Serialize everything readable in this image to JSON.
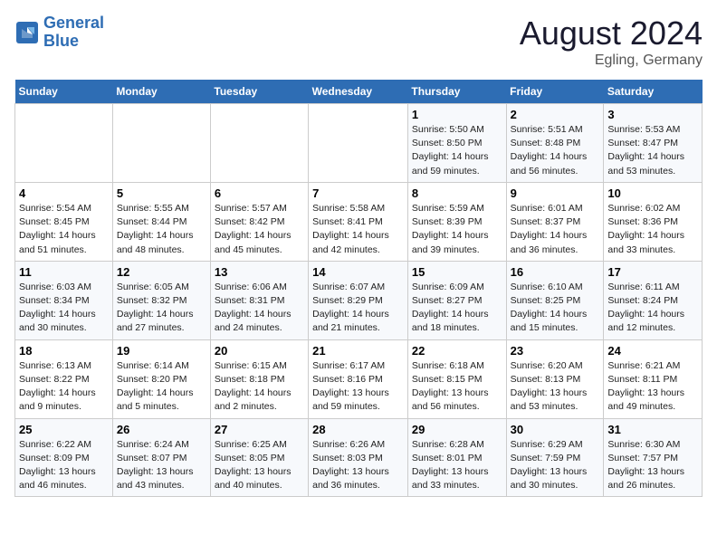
{
  "header": {
    "logo_line1": "General",
    "logo_line2": "Blue",
    "title": "August 2024",
    "subtitle": "Egling, Germany"
  },
  "weekdays": [
    "Sunday",
    "Monday",
    "Tuesday",
    "Wednesday",
    "Thursday",
    "Friday",
    "Saturday"
  ],
  "weeks": [
    [
      {
        "day": "",
        "info": ""
      },
      {
        "day": "",
        "info": ""
      },
      {
        "day": "",
        "info": ""
      },
      {
        "day": "",
        "info": ""
      },
      {
        "day": "1",
        "info": "Sunrise: 5:50 AM\nSunset: 8:50 PM\nDaylight: 14 hours\nand 59 minutes."
      },
      {
        "day": "2",
        "info": "Sunrise: 5:51 AM\nSunset: 8:48 PM\nDaylight: 14 hours\nand 56 minutes."
      },
      {
        "day": "3",
        "info": "Sunrise: 5:53 AM\nSunset: 8:47 PM\nDaylight: 14 hours\nand 53 minutes."
      }
    ],
    [
      {
        "day": "4",
        "info": "Sunrise: 5:54 AM\nSunset: 8:45 PM\nDaylight: 14 hours\nand 51 minutes."
      },
      {
        "day": "5",
        "info": "Sunrise: 5:55 AM\nSunset: 8:44 PM\nDaylight: 14 hours\nand 48 minutes."
      },
      {
        "day": "6",
        "info": "Sunrise: 5:57 AM\nSunset: 8:42 PM\nDaylight: 14 hours\nand 45 minutes."
      },
      {
        "day": "7",
        "info": "Sunrise: 5:58 AM\nSunset: 8:41 PM\nDaylight: 14 hours\nand 42 minutes."
      },
      {
        "day": "8",
        "info": "Sunrise: 5:59 AM\nSunset: 8:39 PM\nDaylight: 14 hours\nand 39 minutes."
      },
      {
        "day": "9",
        "info": "Sunrise: 6:01 AM\nSunset: 8:37 PM\nDaylight: 14 hours\nand 36 minutes."
      },
      {
        "day": "10",
        "info": "Sunrise: 6:02 AM\nSunset: 8:36 PM\nDaylight: 14 hours\nand 33 minutes."
      }
    ],
    [
      {
        "day": "11",
        "info": "Sunrise: 6:03 AM\nSunset: 8:34 PM\nDaylight: 14 hours\nand 30 minutes."
      },
      {
        "day": "12",
        "info": "Sunrise: 6:05 AM\nSunset: 8:32 PM\nDaylight: 14 hours\nand 27 minutes."
      },
      {
        "day": "13",
        "info": "Sunrise: 6:06 AM\nSunset: 8:31 PM\nDaylight: 14 hours\nand 24 minutes."
      },
      {
        "day": "14",
        "info": "Sunrise: 6:07 AM\nSunset: 8:29 PM\nDaylight: 14 hours\nand 21 minutes."
      },
      {
        "day": "15",
        "info": "Sunrise: 6:09 AM\nSunset: 8:27 PM\nDaylight: 14 hours\nand 18 minutes."
      },
      {
        "day": "16",
        "info": "Sunrise: 6:10 AM\nSunset: 8:25 PM\nDaylight: 14 hours\nand 15 minutes."
      },
      {
        "day": "17",
        "info": "Sunrise: 6:11 AM\nSunset: 8:24 PM\nDaylight: 14 hours\nand 12 minutes."
      }
    ],
    [
      {
        "day": "18",
        "info": "Sunrise: 6:13 AM\nSunset: 8:22 PM\nDaylight: 14 hours\nand 9 minutes."
      },
      {
        "day": "19",
        "info": "Sunrise: 6:14 AM\nSunset: 8:20 PM\nDaylight: 14 hours\nand 5 minutes."
      },
      {
        "day": "20",
        "info": "Sunrise: 6:15 AM\nSunset: 8:18 PM\nDaylight: 14 hours\nand 2 minutes."
      },
      {
        "day": "21",
        "info": "Sunrise: 6:17 AM\nSunset: 8:16 PM\nDaylight: 13 hours\nand 59 minutes."
      },
      {
        "day": "22",
        "info": "Sunrise: 6:18 AM\nSunset: 8:15 PM\nDaylight: 13 hours\nand 56 minutes."
      },
      {
        "day": "23",
        "info": "Sunrise: 6:20 AM\nSunset: 8:13 PM\nDaylight: 13 hours\nand 53 minutes."
      },
      {
        "day": "24",
        "info": "Sunrise: 6:21 AM\nSunset: 8:11 PM\nDaylight: 13 hours\nand 49 minutes."
      }
    ],
    [
      {
        "day": "25",
        "info": "Sunrise: 6:22 AM\nSunset: 8:09 PM\nDaylight: 13 hours\nand 46 minutes."
      },
      {
        "day": "26",
        "info": "Sunrise: 6:24 AM\nSunset: 8:07 PM\nDaylight: 13 hours\nand 43 minutes."
      },
      {
        "day": "27",
        "info": "Sunrise: 6:25 AM\nSunset: 8:05 PM\nDaylight: 13 hours\nand 40 minutes."
      },
      {
        "day": "28",
        "info": "Sunrise: 6:26 AM\nSunset: 8:03 PM\nDaylight: 13 hours\nand 36 minutes."
      },
      {
        "day": "29",
        "info": "Sunrise: 6:28 AM\nSunset: 8:01 PM\nDaylight: 13 hours\nand 33 minutes."
      },
      {
        "day": "30",
        "info": "Sunrise: 6:29 AM\nSunset: 7:59 PM\nDaylight: 13 hours\nand 30 minutes."
      },
      {
        "day": "31",
        "info": "Sunrise: 6:30 AM\nSunset: 7:57 PM\nDaylight: 13 hours\nand 26 minutes."
      }
    ]
  ]
}
